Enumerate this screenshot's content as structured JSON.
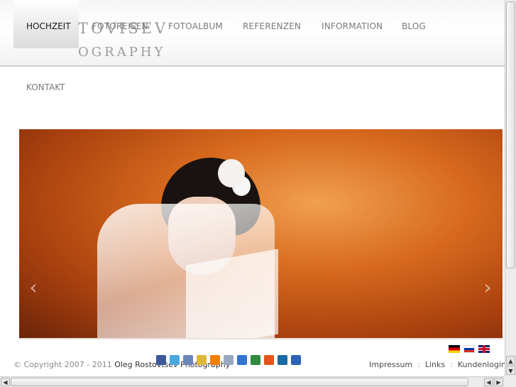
{
  "logo": {
    "line1": "TOVISEV",
    "line2": "OGRAPHY"
  },
  "nav": {
    "active": "HOCHZEIT",
    "items": [
      "FOTOREISEN",
      "FOTOALBUM",
      "REFERENZEN",
      "INFORMATION",
      "BLOG"
    ],
    "row2": "KONTAKT"
  },
  "slider": {
    "prev_icon": "chevron-left-icon",
    "next_icon": "chevron-right-icon",
    "prev_glyph": "‹",
    "next_glyph": "›"
  },
  "footer": {
    "copyright_prefix": "© Copyright 2007 - 2011",
    "copyright_name": "Oleg Rostovtsev",
    "copyright_suffix": "Photography",
    "links": [
      "Impressum",
      "Links",
      "Kundenlogin"
    ],
    "separator": ":",
    "flags": [
      "de-flag-icon",
      "ru-flag-icon",
      "gb-flag-icon"
    ],
    "social": [
      {
        "name": "facebook-icon",
        "color": "#3b5998"
      },
      {
        "name": "twitter-icon",
        "color": "#4aa8e0"
      },
      {
        "name": "myspace-icon",
        "color": "#6d86b8"
      },
      {
        "name": "friends-icon",
        "color": "#e0b73c"
      },
      {
        "name": "blogger-icon",
        "color": "#f57d00"
      },
      {
        "name": "share-icon",
        "color": "#9aa8c4"
      },
      {
        "name": "delicious-icon",
        "color": "#3274d0"
      },
      {
        "name": "google-icon",
        "color": "#2e8b3f"
      },
      {
        "name": "rss-icon",
        "color": "#e2541c"
      },
      {
        "name": "linkedin-icon",
        "color": "#1b6aa5"
      },
      {
        "name": "bookmark-icon",
        "color": "#2c63b6"
      }
    ]
  }
}
